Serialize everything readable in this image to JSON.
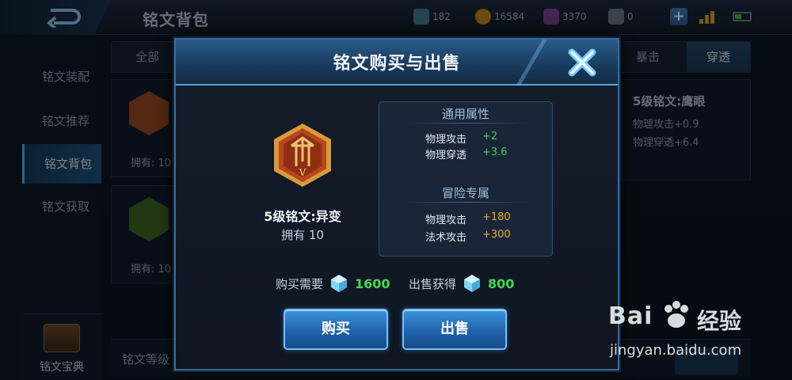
{
  "topbar": {
    "title": "铭文背包",
    "resources": [
      {
        "name": "gem-icon",
        "value": "182",
        "color": "#5aa7c8"
      },
      {
        "name": "coin-icon",
        "value": "16584",
        "color": "#d79a2a"
      },
      {
        "name": "diamond-icon",
        "value": "3370",
        "color": "#8a4fa6"
      },
      {
        "name": "ticket-icon",
        "value": "0",
        "color": "#7c8a99"
      }
    ]
  },
  "sidebar": {
    "items": [
      {
        "label": "铭文装配"
      },
      {
        "label": "铭文推荐"
      },
      {
        "label": "铭文背包"
      },
      {
        "label": "铭文获取"
      }
    ],
    "active_index": 2,
    "book_label": "铭文宝典"
  },
  "background": {
    "tabs": [
      {
        "label": "全部"
      },
      {
        "label": "暴击"
      },
      {
        "label": "穿透"
      }
    ],
    "cards": [
      {
        "owned": "拥有: 10",
        "color": "#b5562a"
      },
      {
        "owned": "拥有: 10",
        "color": "#4e7a2a"
      }
    ],
    "detail": {
      "name": "5级铭文:鹰眼",
      "lines": [
        "物理攻击+0.9",
        "物理穿透+6.4"
      ]
    },
    "bottom_label": "铭文等级"
  },
  "dialog": {
    "title": "铭文购买与出售",
    "item_name": "5级铭文:异变",
    "owned": "拥有 10",
    "emblem_numeral": "V",
    "general_title": "通用属性",
    "general_stats": [
      {
        "label": "物理攻击",
        "value": "+2"
      },
      {
        "label": "物理穿透",
        "value": "+3.6"
      }
    ],
    "adventure_title": "冒险专属",
    "adventure_stats": [
      {
        "label": "物理攻击",
        "value": "+180"
      },
      {
        "label": "法术攻击",
        "value": "+300"
      }
    ],
    "buy_price_label": "购买需要",
    "buy_price": "1600",
    "sell_price_label": "出售获得",
    "sell_price": "800",
    "buy_button": "购买",
    "sell_button": "出售"
  },
  "watermark": {
    "logo": "Bai",
    "logo_cn": "经验",
    "url": "jingyan.baidu.com"
  }
}
